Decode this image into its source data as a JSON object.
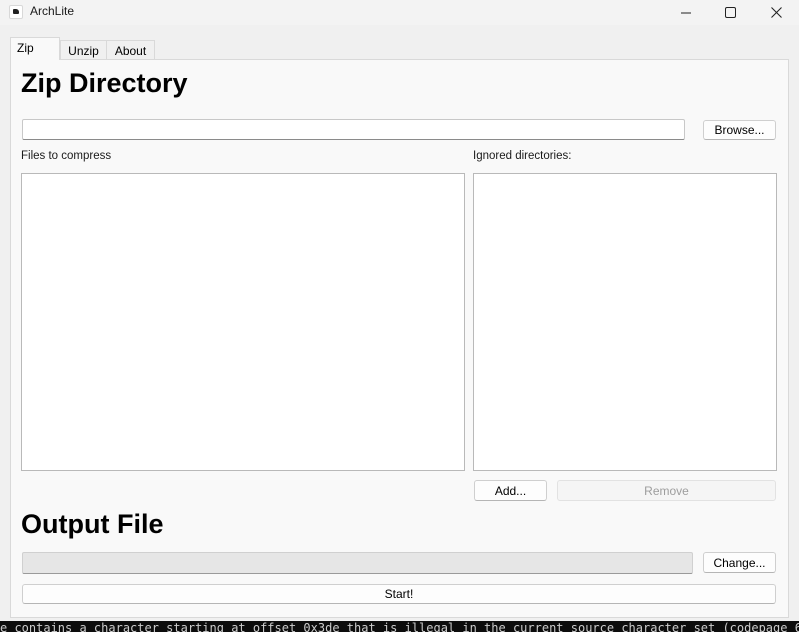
{
  "window": {
    "title": "ArchLite",
    "icon": "archlite-app-icon"
  },
  "tabs": [
    {
      "label": "Zip",
      "active": true
    },
    {
      "label": "Unzip",
      "active": false
    },
    {
      "label": "About",
      "active": false
    }
  ],
  "zip": {
    "heading": "Zip Directory",
    "directory_value": "",
    "browse_label": "Browse...",
    "files_label": "Files to compress",
    "ignored_label": "Ignored directories:",
    "files_items": [],
    "ignored_items": [],
    "add_label": "Add...",
    "remove_label": "Remove",
    "remove_enabled": false
  },
  "output": {
    "heading": "Output File",
    "path_value": "",
    "change_label": "Change...",
    "start_label": "Start!"
  },
  "console": {
    "text": "e contains a character starting at offset 0x3de that is illegal in the current source character set (codepage 65"
  }
}
